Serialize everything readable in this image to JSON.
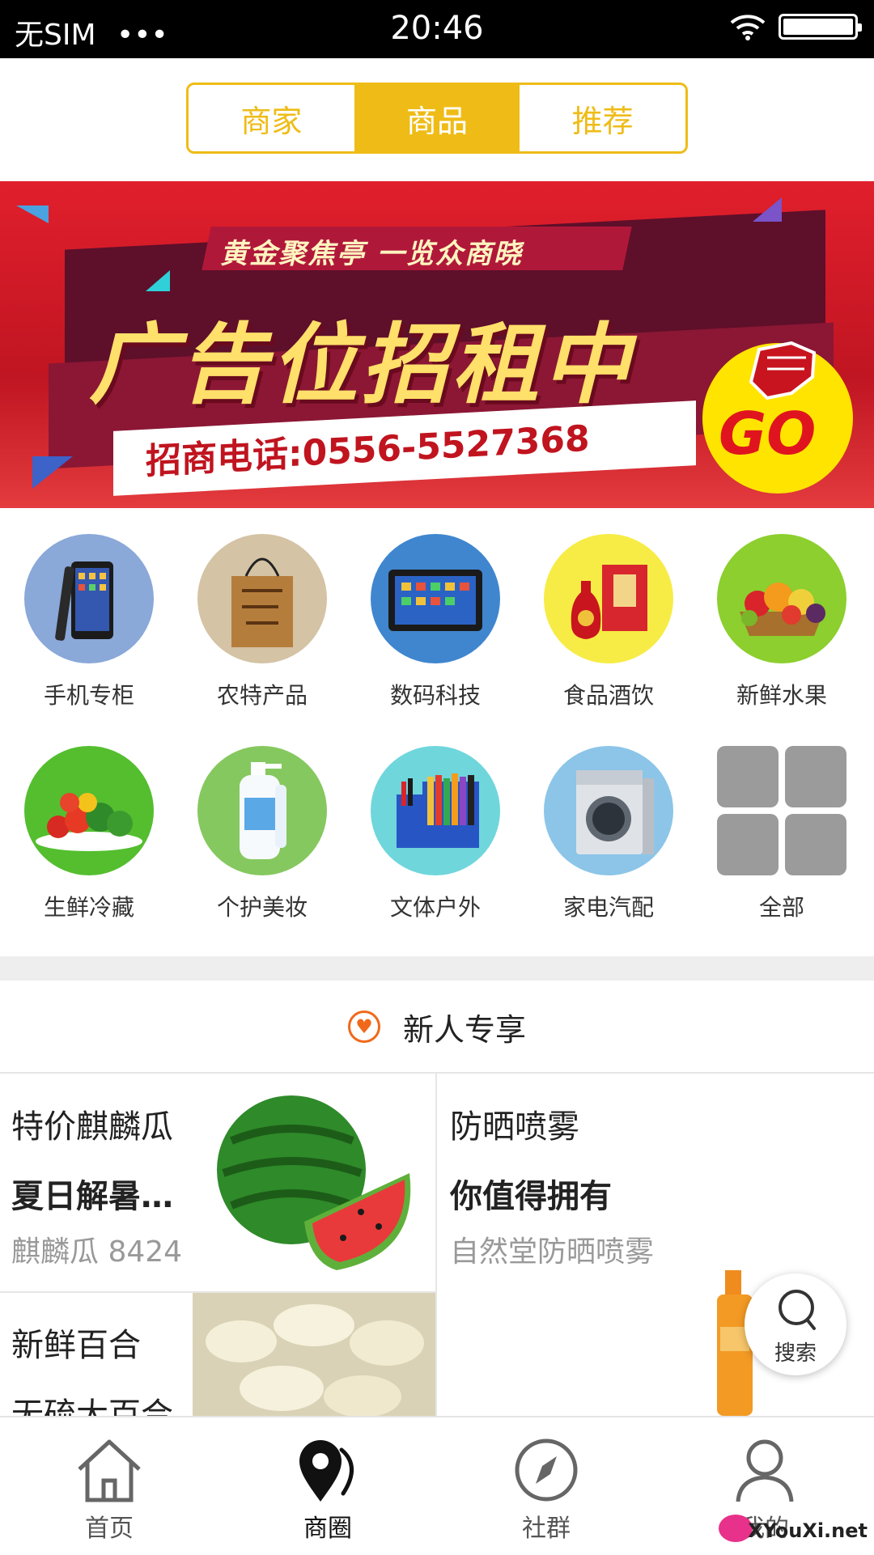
{
  "status_bar": {
    "carrier": "无SIM",
    "signal_dots": "•••",
    "time": "20:46"
  },
  "tabs": [
    {
      "label": "商家",
      "active": false
    },
    {
      "label": "商品",
      "active": true
    },
    {
      "label": "推荐",
      "active": false
    }
  ],
  "colors": {
    "accent": "#efbc17",
    "orange": "#f0691b",
    "banner_red": "#e11f2c"
  },
  "banner": {
    "tagline": "黄金聚焦亭 一览众商晓",
    "headline": "广告位招租中",
    "phone": "招商电话:0556-5527368",
    "go": "GO"
  },
  "categories": [
    {
      "label": "手机专柜",
      "icon": "mobile-phone-icon",
      "color": "#8aa8d8"
    },
    {
      "label": "农特产品",
      "icon": "gift-bag-icon",
      "color": "#d4c3a4"
    },
    {
      "label": "数码科技",
      "icon": "tablet-icon",
      "color": "#3f86cf"
    },
    {
      "label": "食品酒饮",
      "icon": "liquor-bottle-icon",
      "color": "#f7ec45"
    },
    {
      "label": "新鲜水果",
      "icon": "fruit-basket-icon",
      "color": "#8ccf2e"
    },
    {
      "label": "生鲜冷藏",
      "icon": "vegetables-icon",
      "color": "#54be2f"
    },
    {
      "label": "个护美妆",
      "icon": "lotion-bottle-icon",
      "color": "#86c860"
    },
    {
      "label": "文体户外",
      "icon": "stationery-icon",
      "color": "#6fd6dc"
    },
    {
      "label": "家电汽配",
      "icon": "washing-machine-icon",
      "color": "#8cc5e8"
    },
    {
      "label": "全部",
      "icon": "grid-all-icon",
      "color": "#9b9b9b"
    }
  ],
  "section": {
    "title": "新人专享",
    "icon": "heart-icon"
  },
  "promos": [
    {
      "title": "特价麒麟瓜",
      "subtitle": "夏日解暑…",
      "desc": "麒麟瓜 8424",
      "image": "watermelon-image"
    },
    {
      "title": "防晒喷雾",
      "subtitle": "你值得拥有",
      "desc": "自然堂防晒喷雾",
      "image": "sunscreen-spray-image"
    },
    {
      "title": "新鲜百合",
      "subtitle": "无硫大百合",
      "image": "lily-bulb-image"
    }
  ],
  "fab": {
    "label": "搜索",
    "icon": "search-icon"
  },
  "bottom_nav": [
    {
      "label": "首页",
      "icon": "home-icon",
      "active": false
    },
    {
      "label": "商圈",
      "icon": "map-pin-icon",
      "active": true
    },
    {
      "label": "社群",
      "icon": "compass-icon",
      "active": false
    },
    {
      "label": "我的",
      "icon": "user-icon",
      "active": false
    }
  ],
  "watermark": "XYouXi.net"
}
